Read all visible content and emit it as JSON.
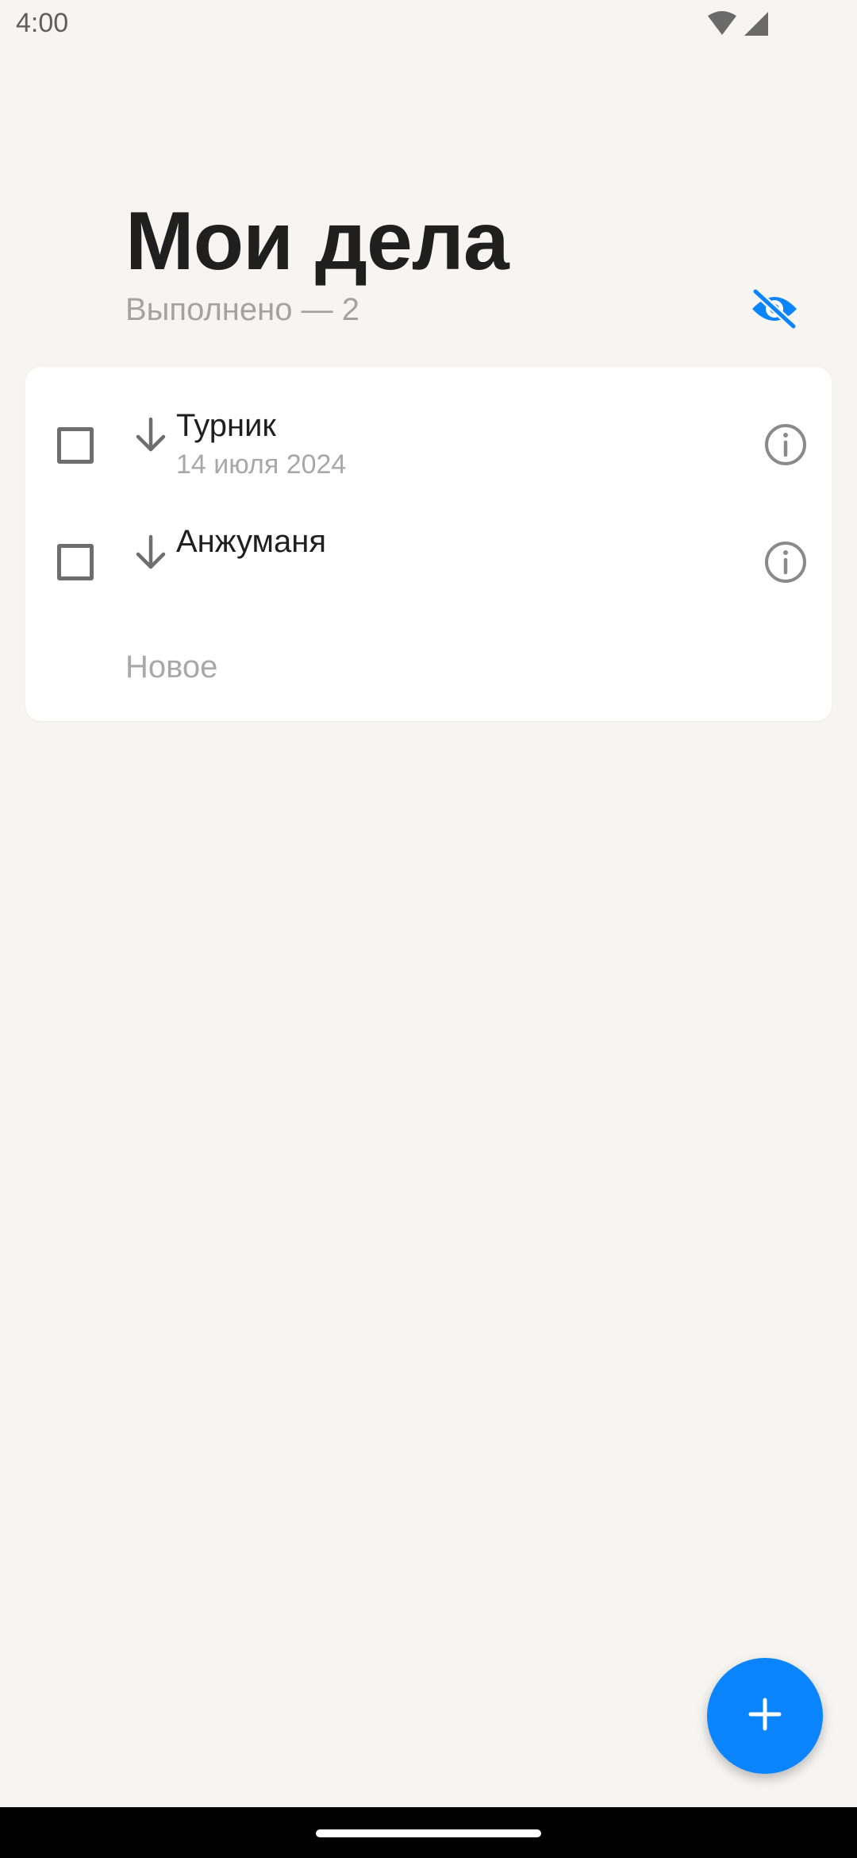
{
  "status_bar": {
    "time": "4:00",
    "icons": [
      "wifi-icon",
      "signal-icon"
    ]
  },
  "header": {
    "title": "Мои дела",
    "done_counter": "Выполнено — 2",
    "visibility_icon": "eye-off-icon"
  },
  "tasks": [
    {
      "title": "Турник",
      "date": "14 июля 2024",
      "priority_icon": "arrow-down-icon",
      "checked": false
    },
    {
      "title": "Анжуманя",
      "priority_icon": "arrow-down-icon",
      "checked": false
    }
  ],
  "new_task_placeholder": "Новое",
  "fab_icon": "plus-icon",
  "colors": {
    "background": "#f6f5f2",
    "accent": "#0a84ff",
    "card": "#ffffff",
    "text_primary": "#1f1f1f",
    "text_secondary": "#a8a8a8"
  }
}
